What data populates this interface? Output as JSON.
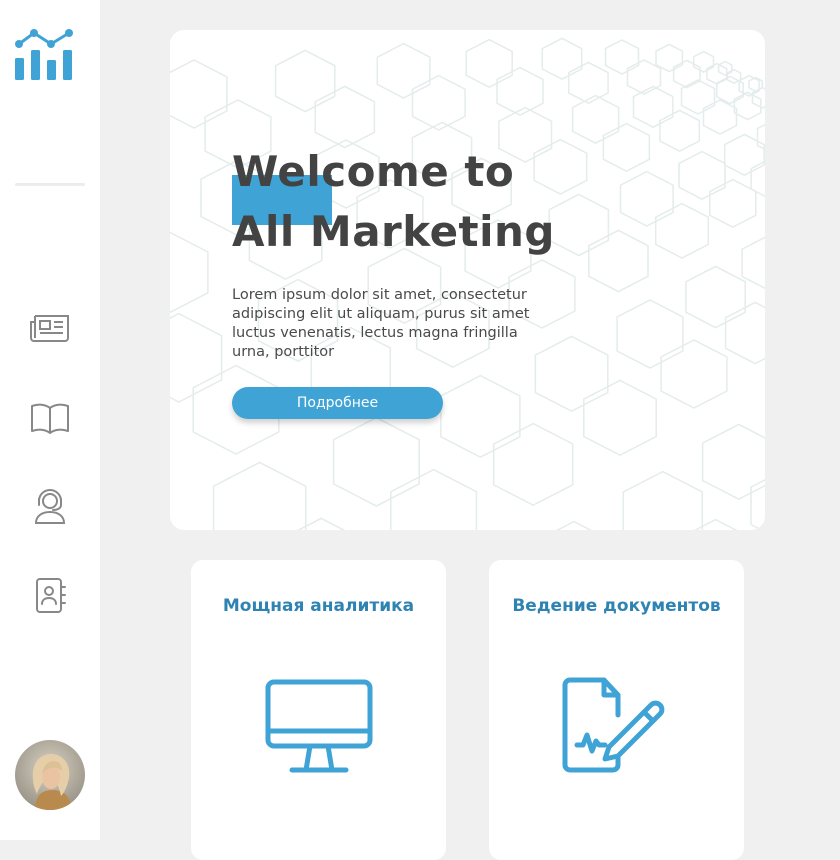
{
  "colors": {
    "accent": "#3fa3d6",
    "heading": "#434343",
    "card_title": "#2f83b3",
    "sidebar_icon": "#888888"
  },
  "sidebar": {
    "logo_icon": "chart-logo-icon",
    "items": [
      {
        "name": "news",
        "icon": "newspaper-icon"
      },
      {
        "name": "book",
        "icon": "book-icon"
      },
      {
        "name": "support",
        "icon": "headset-user-icon"
      },
      {
        "name": "contacts",
        "icon": "contact-book-icon"
      }
    ],
    "avatar": "user-avatar"
  },
  "hero": {
    "title_line1": "Welcome to",
    "title_line2": "All Marketing",
    "text": "Lorem ipsum dolor sit amet, consectetur adipiscing elit ut aliquam, purus sit amet luctus venenatis, lectus magna fringilla urna, porttitor",
    "button_label": "Подробнее"
  },
  "cards": [
    {
      "title": "Мощная аналитика",
      "icon": "monitor-icon"
    },
    {
      "title": "Ведение документов",
      "icon": "document-sign-icon"
    }
  ]
}
